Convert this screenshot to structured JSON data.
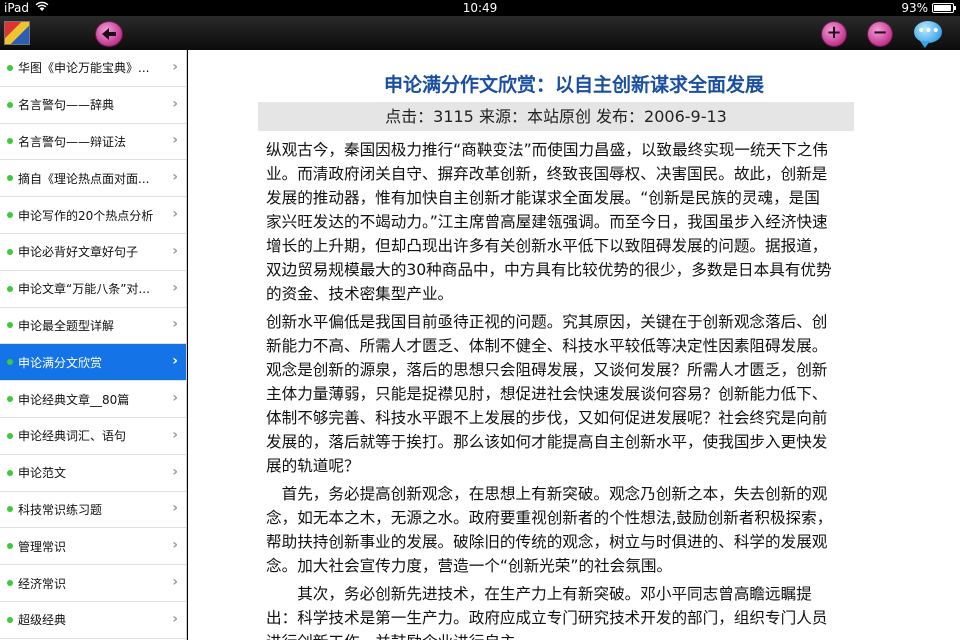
{
  "status": {
    "device": "iPad",
    "time": "10:49",
    "battery": "93%",
    "battery_fill": 0.93
  },
  "toolbar": {
    "back_icon": "back-arrow-icon",
    "plus_icon": "zoom-in-icon",
    "minus_icon": "zoom-out-icon",
    "chat_icon": "comment-icon"
  },
  "sidebar": {
    "items": [
      {
        "label": "华图《申论万能宝典》..."
      },
      {
        "label": "名言警句——辞典"
      },
      {
        "label": "名言警句——辩证法"
      },
      {
        "label": "摘自《理论热点面对面..."
      },
      {
        "label": "申论写作的20个热点分析"
      },
      {
        "label": "申论必背好文章好句子"
      },
      {
        "label": "申论文章“万能八条”对..."
      },
      {
        "label": "申论最全题型详解"
      },
      {
        "label": "申论满分文欣赏"
      },
      {
        "label": "申论经典文章__80篇"
      },
      {
        "label": "申论经典词汇、语句"
      },
      {
        "label": "申论范文"
      },
      {
        "label": "科技常识练习题"
      },
      {
        "label": "管理常识"
      },
      {
        "label": "经济常识"
      },
      {
        "label": "超级经典"
      }
    ],
    "active_index": 8
  },
  "article": {
    "title": "申论满分作文欣赏：以自主创新谋求全面发展",
    "meta": "点击：3115  来源：本站原创  发布：2006-9-13",
    "paragraphs": [
      "纵观古今，秦国因极力推行“商鞅变法”而使国力昌盛，以致最终实现一统天下之伟业。而清政府闭关自守、摒弃改革创新，终致丧国辱权、决害国民。故此，创新是发展的推动器，惟有加快自主创新才能谋求全面发展。“创新是民族的灵魂，是国家兴旺发达的不竭动力。”江主席曾高屋建瓴强调。而至今日，我国虽步入经济快速增长的上升期，但却凸现出许多有关创新水平低下以致阻碍发展的问题。据报道，双边贸易规模最大的30种商品中，中方具有比较优势的很少，多数是日本具有优势的资金、技术密集型产业。",
      "创新水平偏低是我国目前亟待正视的问题。究其原因，关键在于创新观念落后、创新能力不高、所需人才匮乏、体制不健全、科技水平较低等决定性因素阻碍发展。观念是创新的源泉，落后的思想只会阻碍发展，又谈何发展？所需人才匮乏，创新主体力量薄弱，只能是捉襟见肘，想促进社会快速发展谈何容易？创新能力低下、体制不够完善、科技水平跟不上发展的步伐，又如何促进发展呢？社会终究是向前发展的，落后就等于挨打。那么该如何才能提高自主创新水平，使我国步入更快发展的轨道呢？",
      "　首先，务必提高创新观念，在思想上有新突破。观念乃创新之本，失去创新的观念，如无本之木，无源之水。政府要重视创新者的个性想法,鼓励创新者积极探索，帮助扶持创新事业的发展。破除旧的传统的观念，树立与时俱进的、科学的发展观念。加大社会宣传力度，营造一个“创新光荣”的社会氛围。",
      "　　其次，务必创新先进技术，在生产力上有新突破。邓小平同志曾高瞻远瞩提出：科学技术是第一生产力。政府应成立专门研究技术开发的部门，组织专门人员进行创新工作。并鼓励企业进行自主"
    ]
  }
}
